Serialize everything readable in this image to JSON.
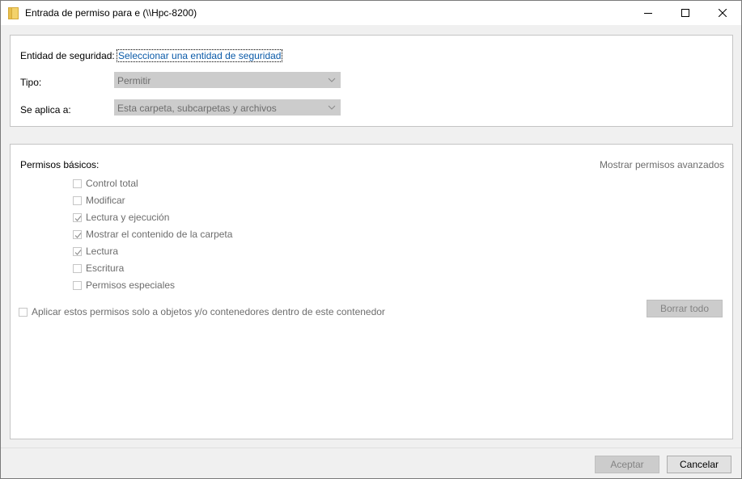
{
  "window": {
    "title": "Entrada de permiso para e (\\\\Hpc-8200)",
    "controls": {
      "minimize": "minimize-icon",
      "maximize": "maximize-icon",
      "close": "close-icon"
    }
  },
  "principal": {
    "label": "Entidad de seguridad:",
    "link": "Seleccionar una entidad de seguridad"
  },
  "type": {
    "label": "Tipo:",
    "value": "Permitir"
  },
  "applies_to": {
    "label": "Se aplica a:",
    "value": "Esta carpeta, subcarpetas y archivos"
  },
  "permissions": {
    "heading": "Permisos básicos:",
    "advanced_link": "Mostrar permisos avanzados",
    "items": [
      {
        "label": "Control total",
        "checked": false
      },
      {
        "label": "Modificar",
        "checked": false
      },
      {
        "label": "Lectura y ejecución",
        "checked": true
      },
      {
        "label": "Mostrar el contenido de la carpeta",
        "checked": true
      },
      {
        "label": "Lectura",
        "checked": true
      },
      {
        "label": "Escritura",
        "checked": false
      },
      {
        "label": "Permisos especiales",
        "checked": false
      }
    ],
    "apply_only_label": "Aplicar estos permisos solo a objetos y/o contenedores dentro de este contenedor",
    "clear_all_label": "Borrar todo"
  },
  "footer": {
    "ok_label": "Aceptar",
    "cancel_label": "Cancelar"
  },
  "colors": {
    "link": "#0a5aa8",
    "disabled_text": "#6d6d6d",
    "window_bg": "#f0f0f0"
  }
}
